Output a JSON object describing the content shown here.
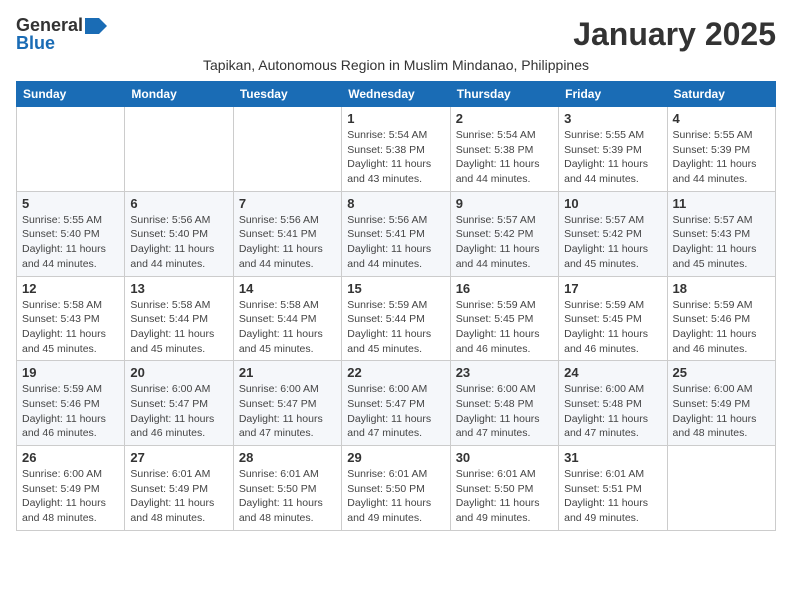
{
  "logo": {
    "general": "General",
    "blue": "Blue"
  },
  "title": "January 2025",
  "subtitle": "Tapikan, Autonomous Region in Muslim Mindanao, Philippines",
  "weekdays": [
    "Sunday",
    "Monday",
    "Tuesday",
    "Wednesday",
    "Thursday",
    "Friday",
    "Saturday"
  ],
  "weeks": [
    [
      {
        "day": "",
        "info": ""
      },
      {
        "day": "",
        "info": ""
      },
      {
        "day": "",
        "info": ""
      },
      {
        "day": "1",
        "info": "Sunrise: 5:54 AM\nSunset: 5:38 PM\nDaylight: 11 hours and 43 minutes."
      },
      {
        "day": "2",
        "info": "Sunrise: 5:54 AM\nSunset: 5:38 PM\nDaylight: 11 hours and 44 minutes."
      },
      {
        "day": "3",
        "info": "Sunrise: 5:55 AM\nSunset: 5:39 PM\nDaylight: 11 hours and 44 minutes."
      },
      {
        "day": "4",
        "info": "Sunrise: 5:55 AM\nSunset: 5:39 PM\nDaylight: 11 hours and 44 minutes."
      }
    ],
    [
      {
        "day": "5",
        "info": "Sunrise: 5:55 AM\nSunset: 5:40 PM\nDaylight: 11 hours and 44 minutes."
      },
      {
        "day": "6",
        "info": "Sunrise: 5:56 AM\nSunset: 5:40 PM\nDaylight: 11 hours and 44 minutes."
      },
      {
        "day": "7",
        "info": "Sunrise: 5:56 AM\nSunset: 5:41 PM\nDaylight: 11 hours and 44 minutes."
      },
      {
        "day": "8",
        "info": "Sunrise: 5:56 AM\nSunset: 5:41 PM\nDaylight: 11 hours and 44 minutes."
      },
      {
        "day": "9",
        "info": "Sunrise: 5:57 AM\nSunset: 5:42 PM\nDaylight: 11 hours and 44 minutes."
      },
      {
        "day": "10",
        "info": "Sunrise: 5:57 AM\nSunset: 5:42 PM\nDaylight: 11 hours and 45 minutes."
      },
      {
        "day": "11",
        "info": "Sunrise: 5:57 AM\nSunset: 5:43 PM\nDaylight: 11 hours and 45 minutes."
      }
    ],
    [
      {
        "day": "12",
        "info": "Sunrise: 5:58 AM\nSunset: 5:43 PM\nDaylight: 11 hours and 45 minutes."
      },
      {
        "day": "13",
        "info": "Sunrise: 5:58 AM\nSunset: 5:44 PM\nDaylight: 11 hours and 45 minutes."
      },
      {
        "day": "14",
        "info": "Sunrise: 5:58 AM\nSunset: 5:44 PM\nDaylight: 11 hours and 45 minutes."
      },
      {
        "day": "15",
        "info": "Sunrise: 5:59 AM\nSunset: 5:44 PM\nDaylight: 11 hours and 45 minutes."
      },
      {
        "day": "16",
        "info": "Sunrise: 5:59 AM\nSunset: 5:45 PM\nDaylight: 11 hours and 46 minutes."
      },
      {
        "day": "17",
        "info": "Sunrise: 5:59 AM\nSunset: 5:45 PM\nDaylight: 11 hours and 46 minutes."
      },
      {
        "day": "18",
        "info": "Sunrise: 5:59 AM\nSunset: 5:46 PM\nDaylight: 11 hours and 46 minutes."
      }
    ],
    [
      {
        "day": "19",
        "info": "Sunrise: 5:59 AM\nSunset: 5:46 PM\nDaylight: 11 hours and 46 minutes."
      },
      {
        "day": "20",
        "info": "Sunrise: 6:00 AM\nSunset: 5:47 PM\nDaylight: 11 hours and 46 minutes."
      },
      {
        "day": "21",
        "info": "Sunrise: 6:00 AM\nSunset: 5:47 PM\nDaylight: 11 hours and 47 minutes."
      },
      {
        "day": "22",
        "info": "Sunrise: 6:00 AM\nSunset: 5:47 PM\nDaylight: 11 hours and 47 minutes."
      },
      {
        "day": "23",
        "info": "Sunrise: 6:00 AM\nSunset: 5:48 PM\nDaylight: 11 hours and 47 minutes."
      },
      {
        "day": "24",
        "info": "Sunrise: 6:00 AM\nSunset: 5:48 PM\nDaylight: 11 hours and 47 minutes."
      },
      {
        "day": "25",
        "info": "Sunrise: 6:00 AM\nSunset: 5:49 PM\nDaylight: 11 hours and 48 minutes."
      }
    ],
    [
      {
        "day": "26",
        "info": "Sunrise: 6:00 AM\nSunset: 5:49 PM\nDaylight: 11 hours and 48 minutes."
      },
      {
        "day": "27",
        "info": "Sunrise: 6:01 AM\nSunset: 5:49 PM\nDaylight: 11 hours and 48 minutes."
      },
      {
        "day": "28",
        "info": "Sunrise: 6:01 AM\nSunset: 5:50 PM\nDaylight: 11 hours and 48 minutes."
      },
      {
        "day": "29",
        "info": "Sunrise: 6:01 AM\nSunset: 5:50 PM\nDaylight: 11 hours and 49 minutes."
      },
      {
        "day": "30",
        "info": "Sunrise: 6:01 AM\nSunset: 5:50 PM\nDaylight: 11 hours and 49 minutes."
      },
      {
        "day": "31",
        "info": "Sunrise: 6:01 AM\nSunset: 5:51 PM\nDaylight: 11 hours and 49 minutes."
      },
      {
        "day": "",
        "info": ""
      }
    ]
  ]
}
